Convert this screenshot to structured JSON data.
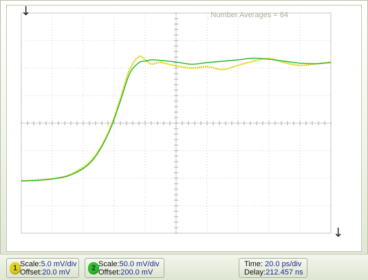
{
  "overlay": {
    "averages": "Number Averages = 64"
  },
  "channel1": {
    "number": "1",
    "scale_label": "Scale:",
    "scale_value": "5.0 mV/div",
    "offset_label": "Offset:",
    "offset_value": "20.0 mV",
    "color": "#d8d000"
  },
  "channel2": {
    "number": "2",
    "scale_label": "Scale:",
    "scale_value": "50.0 mV/div",
    "offset_label": "Offset:",
    "offset_value": "200.0 mV",
    "color": "#22b822"
  },
  "timebase": {
    "time_label": "Time:",
    "time_value": "20.0 ps/div",
    "delay_label": "Delay:",
    "delay_value": "212.457 ns"
  },
  "icons": {
    "trigger_marker": "down-arrow-icon",
    "ground_marker": "down-arrow-icon"
  },
  "chart_data": {
    "type": "line",
    "grid": true,
    "divisions": {
      "x": 10,
      "y": 8
    },
    "x": [
      0,
      0.5,
      1.0,
      1.5,
      2.0,
      2.3,
      2.6,
      2.9,
      3.2,
      3.5,
      3.8,
      4.0,
      4.2,
      4.5,
      5.0,
      5.5,
      6.0,
      6.5,
      7.0,
      7.5,
      8.0,
      8.5,
      9.0,
      9.5,
      10.0
    ],
    "series": [
      {
        "color": "#d8d000",
        "y": [
          -2.1,
          -2.07,
          -2.02,
          -1.9,
          -1.6,
          -1.3,
          -0.8,
          -0.1,
          0.9,
          1.95,
          2.42,
          2.3,
          2.15,
          2.2,
          2.08,
          2.0,
          2.05,
          1.95,
          2.1,
          2.25,
          2.35,
          2.2,
          2.1,
          2.15,
          2.22
        ]
      },
      {
        "color": "#22b822",
        "y": [
          -2.1,
          -2.08,
          -2.03,
          -1.92,
          -1.65,
          -1.35,
          -0.85,
          -0.15,
          0.8,
          1.8,
          2.2,
          2.25,
          2.3,
          2.28,
          2.22,
          2.14,
          2.2,
          2.25,
          2.3,
          2.36,
          2.32,
          2.25,
          2.18,
          2.16,
          2.2
        ]
      }
    ]
  }
}
